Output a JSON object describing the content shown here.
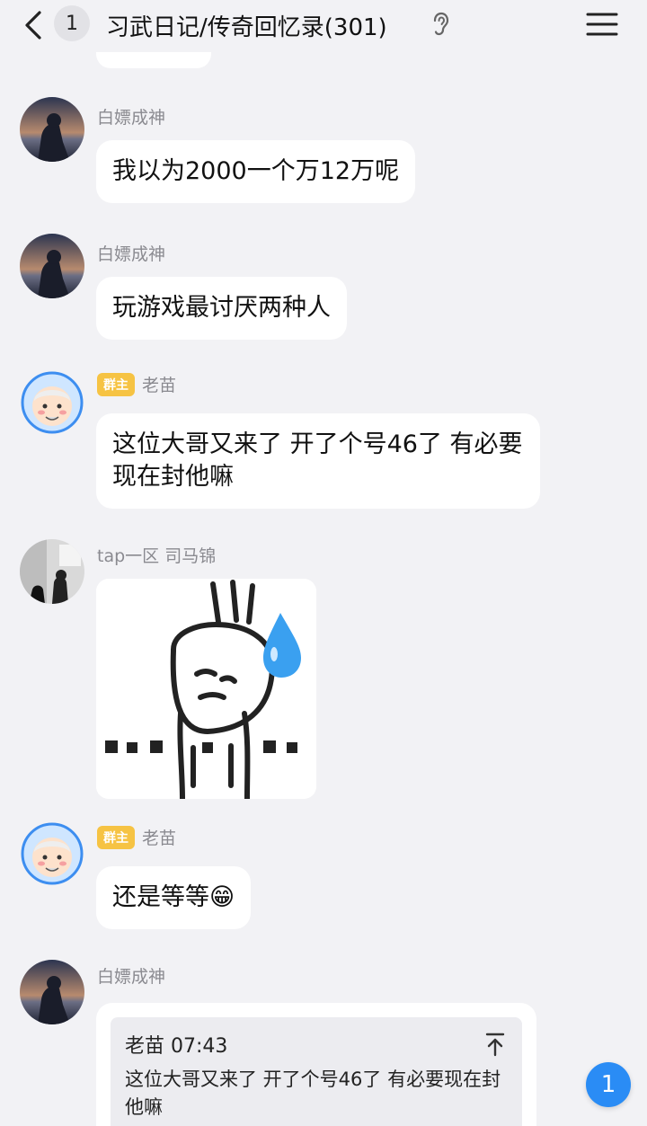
{
  "header": {
    "unread_count": "1",
    "title": "习武日记/传奇回忆录(301)"
  },
  "messages": [
    {
      "sender": "白嫖成神",
      "text": "我以为2000一个万12万呢"
    },
    {
      "sender": "白嫖成神",
      "text": "玩游戏最讨厌两种人"
    },
    {
      "badge": "群主",
      "sender": "老苗",
      "text": "这位大哥又来了 开了个号46了 有必要现在封他嘛"
    },
    {
      "sender": "tap一区 司马锦",
      "sticker": "sweating-rabbit-sticker"
    },
    {
      "badge": "群主",
      "sender": "老苗",
      "text": "还是等等😁"
    },
    {
      "sender": "白嫖成神",
      "quote": {
        "header": "老苗 07:43",
        "text": "这位大哥又来了 开了个号46了 有必要现在封他嘛"
      }
    }
  ],
  "new_message_count": "1",
  "colors": {
    "background": "#f2f2f5",
    "bubble": "#ffffff",
    "badge": "#f6c343",
    "accent": "#2a8cf5"
  }
}
